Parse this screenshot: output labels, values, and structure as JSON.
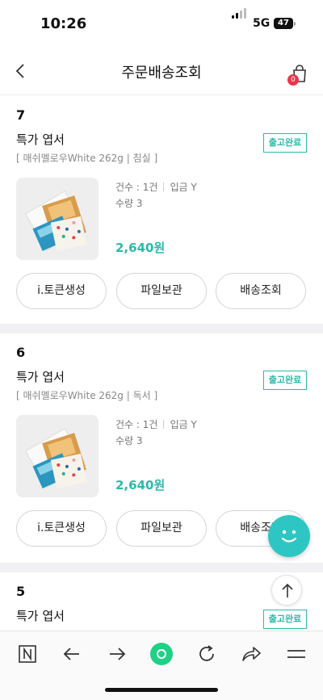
{
  "status_bar": {
    "time": "10:26",
    "network": "5G",
    "battery": "47"
  },
  "header": {
    "title": "주문배송조회",
    "cart_count": "0"
  },
  "orders": [
    {
      "number": "7",
      "product": "특가 엽서",
      "spec": "[ 매쉬멜로우White 262g | 침실 ]",
      "status": "출고완료",
      "count": "건수 : 1건",
      "paid": "입금 Y",
      "quantity": "수량 3",
      "price": "2,640원",
      "buttons": [
        "i.토큰생성",
        "파일보관",
        "배송조회"
      ]
    },
    {
      "number": "6",
      "product": "특가 엽서",
      "spec": "[ 매쉬멜로우White 262g | 독서 ]",
      "status": "출고완료",
      "count": "건수 : 1건",
      "paid": "입금 Y",
      "quantity": "수량 3",
      "price": "2,640원",
      "buttons": [
        "i.토큰생성",
        "파일보관",
        "배송조회"
      ]
    },
    {
      "number": "5",
      "product": "특가 엽서",
      "status": "출고완료"
    }
  ],
  "icons": {
    "back": "chevron-left-icon",
    "cart": "shopping-bag-icon",
    "chat": "chatbot-face-icon",
    "scroll_top": "arrow-up-icon",
    "toolbar": [
      "naver-n-icon",
      "arrow-left-icon",
      "arrow-right-icon",
      "green-dot-icon",
      "reload-icon",
      "share-icon",
      "menu-icon"
    ]
  },
  "colors": {
    "accent": "#2db9a9",
    "badge": "#e8364c",
    "fab": "#2ec6c2",
    "toolbar_dot": "#1fd185"
  }
}
